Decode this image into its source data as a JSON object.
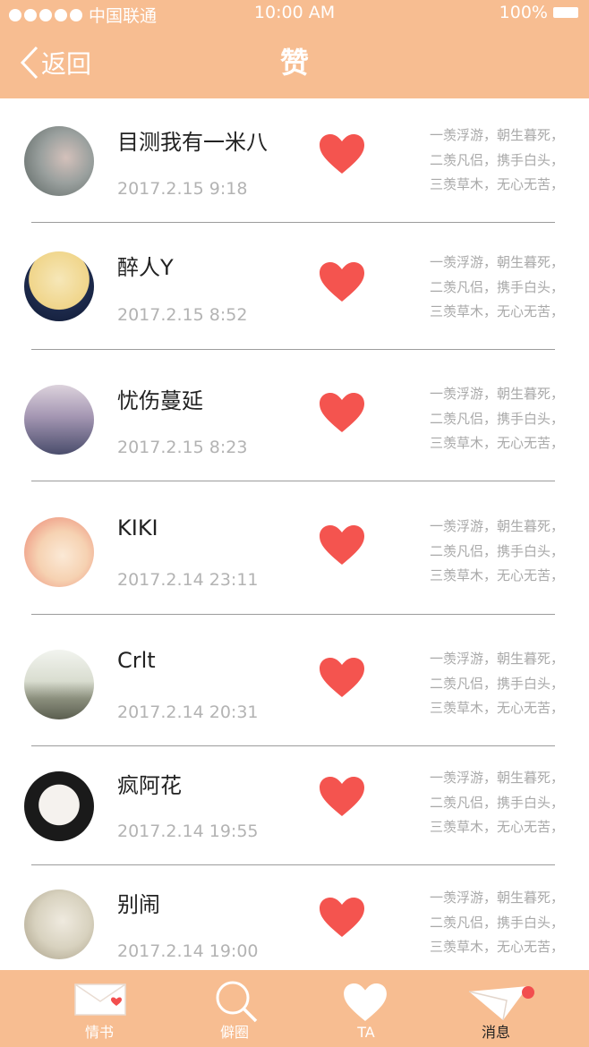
{
  "status": {
    "carrier": "中国联通",
    "time": "10:00 AM",
    "battery": "100%"
  },
  "nav": {
    "back_label": "返回",
    "title": "赞"
  },
  "poem": [
    "一羡浮游，朝生暮死，",
    "二羡凡侣，携手白头，",
    "三羡草木，无心无苦，"
  ],
  "items": [
    {
      "name": "目测我有一米八",
      "date": "2017.2.15   9:18"
    },
    {
      "name": "醉人Y",
      "date": "2017.2.15   8:52"
    },
    {
      "name": "忧伤蔓延",
      "date": "2017.2.15   8:23"
    },
    {
      "name": "KIKI",
      "date": "2017.2.14   23:11"
    },
    {
      "name": "Crlt",
      "date": "2017.2.14   20:31"
    },
    {
      "name": "疯阿花",
      "date": "2017.2.14   19:55"
    },
    {
      "name": "别闹",
      "date": "2017.2.14   19:00"
    }
  ],
  "tabs": [
    {
      "label": "情书",
      "icon": "envelope-icon"
    },
    {
      "label": "僻圈",
      "icon": "search-icon"
    },
    {
      "label": "TA",
      "icon": "heart-icon"
    },
    {
      "label": "消息",
      "icon": "paper-plane-icon",
      "active": true,
      "badge": true
    }
  ],
  "colors": {
    "accent": "#f7bd91",
    "heart": "#f4544f",
    "badge": "#f24e4e"
  }
}
